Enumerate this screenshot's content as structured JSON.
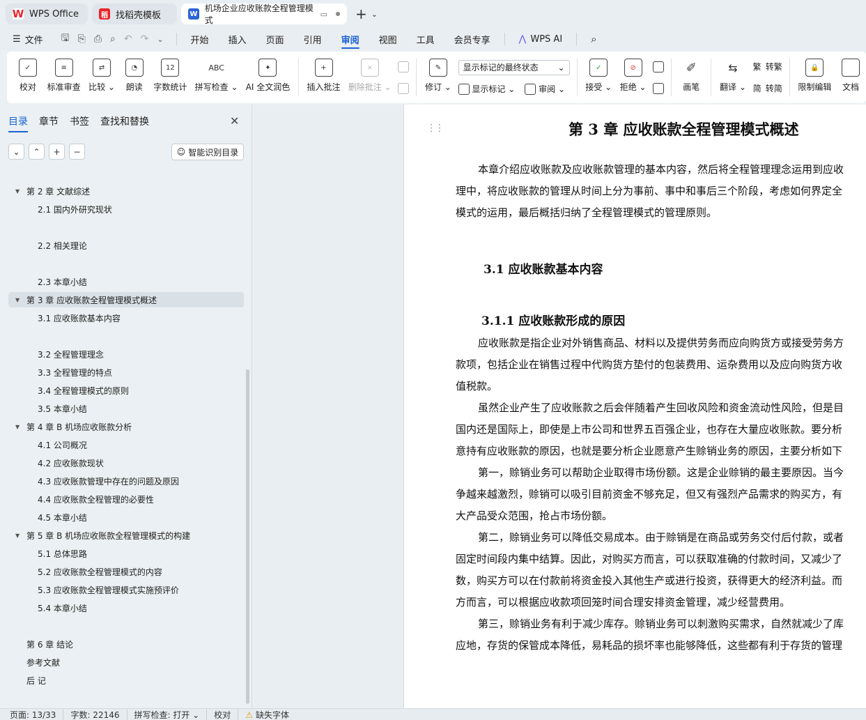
{
  "tabs": [
    {
      "label": "WPS Office",
      "icon": "wps-logo-icon"
    },
    {
      "label": "找稻壳模板",
      "icon": "docer-logo-icon"
    },
    {
      "label": "机场企业应收账款全程管理模式",
      "icon": "word-doc-icon"
    }
  ],
  "menu": {
    "file": "文件",
    "items": [
      "开始",
      "插入",
      "页面",
      "引用",
      "审阅",
      "视图",
      "工具",
      "会员专享"
    ],
    "active": "审阅",
    "ai": "WPS AI"
  },
  "ribbon": {
    "proofread": "校对",
    "std_review": "标准审查",
    "compare": "比较",
    "read_aloud": "朗读",
    "word_count": "字数统计",
    "spell_check": "拼写检查",
    "ai_polish": "AI 全文润色",
    "insert_comment": "插入批注",
    "delete_comment": "删除批注",
    "track_changes": "修订",
    "show_markup_select": "显示标记的最终状态",
    "show_markup": "显示标记",
    "review": "审阅",
    "accept": "接受",
    "reject": "拒绝",
    "pen": "画笔",
    "translate": "翻译",
    "to_traditional": "转繁",
    "to_simplified": "转简",
    "restrict_edit": "限制编辑",
    "doc_protect": "文档"
  },
  "nav": {
    "tabs": [
      "目录",
      "章节",
      "书签",
      "查找和替换"
    ],
    "active_tab": "目录",
    "smart_toc": "智能识别目录",
    "toc": [
      {
        "label": "第 2 章  文献综述",
        "level": 1,
        "expanded": true,
        "selected": false
      },
      {
        "label": "2.1 国内外研究现状",
        "level": 2
      },
      {
        "label": "2.2 相关理论",
        "level": 2
      },
      {
        "label": "2.3 本章小结",
        "level": 2
      },
      {
        "label": "第 3 章  应收账款全程管理模式概述",
        "level": 1,
        "expanded": true,
        "selected": true
      },
      {
        "label": "3.1 应收账款基本内容",
        "level": 2
      },
      {
        "label": "3.2 全程管理理念",
        "level": 2
      },
      {
        "label": "3.3 全程管理的特点",
        "level": 2
      },
      {
        "label": "3.4 全程管理模式的原则",
        "level": 2
      },
      {
        "label": "3.5 本章小结",
        "level": 2
      },
      {
        "label": "第 4 章  B 机场应收账款分析",
        "level": 1,
        "expanded": true
      },
      {
        "label": "4.1  公司概况",
        "level": 2
      },
      {
        "label": "4.2  应收账款现状",
        "level": 2
      },
      {
        "label": "4.3  应收账款管理中存在的问题及原因",
        "level": 2
      },
      {
        "label": "4.4  应收账款全程管理的必要性",
        "level": 2
      },
      {
        "label": "4.5  本章小结",
        "level": 2
      },
      {
        "label": "第 5 章 B 机场应收账款全程管理模式的构建",
        "level": 1,
        "expanded": true
      },
      {
        "label": "5.1  总体思路",
        "level": 2
      },
      {
        "label": "5.2  应收账款全程管理模式的内容",
        "level": 2
      },
      {
        "label": "5.3  应收账款全程管理模式实施预评价",
        "level": 2
      },
      {
        "label": "5.4  本章小结",
        "level": 2
      },
      {
        "label": "第 6 章  结论",
        "level": 1
      },
      {
        "label": "参考文献",
        "level": 1
      },
      {
        "label": "后  记",
        "level": 1
      }
    ]
  },
  "document": {
    "title": "第 3 章  应收账款全程管理模式概述",
    "h2": "3.1 应收账款基本内容",
    "h3": "3.1.1 应收账款形成的原因",
    "intro_lines": [
      "本章介绍应收账款及应收账款管理的基本内容，然后将全程管理理念运用到应收",
      "理中，将应收账款的管理从时间上分为事前、事中和事后三个阶段，考虑如何界定全",
      "模式的运用，最后概括归纳了全程管理模式的管理原则。"
    ],
    "body_lines": [
      "应收账款是指企业对外销售商品、材料以及提供劳务而应向购货方或接受劳务方",
      "款项，包括企业在销售过程中代购货方垫付的包装费用、运杂费用以及应向购货方收",
      "值税款。",
      "虽然企业产生了应收账款之后会伴随着产生回收风险和资金流动性风险，但是目",
      "国内还是国际上，即使是上市公司和世界五百强企业，也存在大量应收账款。要分析",
      "意持有应收账款的原因，也就是要分析企业愿意产生赊销业务的原因，主要分析如下",
      "第一，赊销业务可以帮助企业取得市场份额。这是企业赊销的最主要原因。当今",
      "争越来越激烈，赊销可以吸引目前资金不够充足，但又有强烈产品需求的购买方，有",
      "大产品受众范围，抢占市场份额。",
      "第二，赊销业务可以降低交易成本。由于赊销是在商品或劳务交付后付款，或者",
      "固定时间段内集中结算。因此，对购买方而言，可以获取准确的付款时间，又减少了",
      "数，购买方可以在付款前将资金投入其他生产或进行投资，获得更大的经济利益。而",
      "方而言，可以根据应收款项回笼时间合理安排资金管理，减少经营费用。",
      "第三，赊销业务有利于减少库存。赊销业务可以刺激购买需求，自然就减少了库",
      "应地，存货的保管成本降低，易耗品的损坏率也能够降低，这些都有利于存货的管理"
    ]
  },
  "status": {
    "page": "页面: 13/33",
    "words": "字数: 22146",
    "spell": "拼写检查: 打开",
    "proof": "校对",
    "missing_font": "缺失字体"
  }
}
